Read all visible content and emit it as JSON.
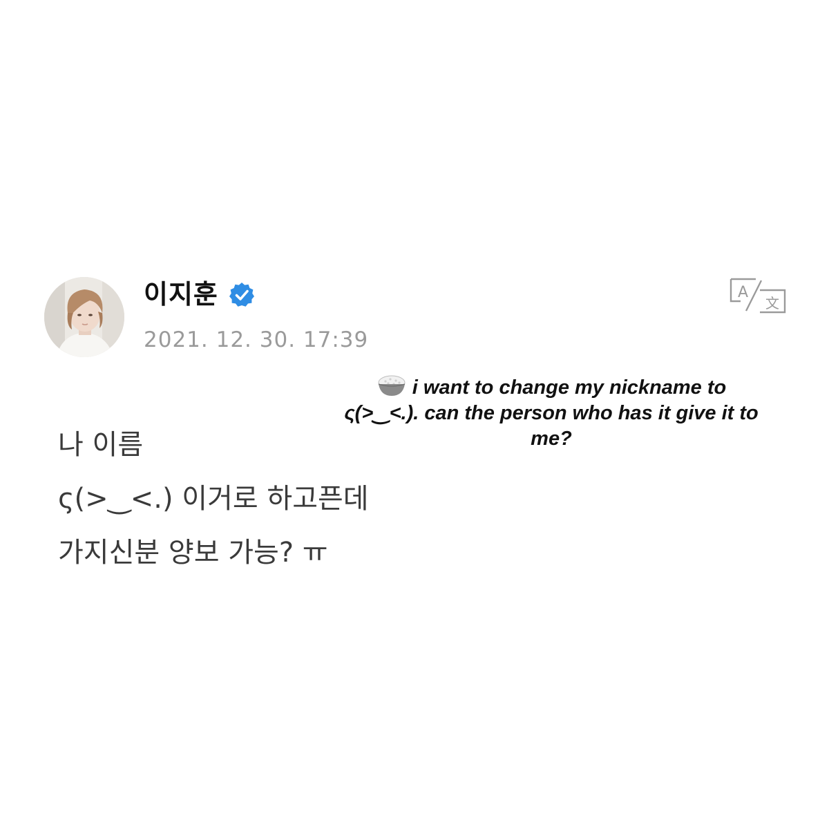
{
  "post": {
    "author": {
      "name": "이지훈",
      "verified": true,
      "avatar_icon": "avatar-photo"
    },
    "timestamp": "2021. 12. 30. 17:39",
    "translate_icon": "translate-icon",
    "body_lines": [
      "나 이름",
      "ς(>‿<.) 이거로 하고픈데",
      "가지신분 양보 가능? ㅠ"
    ]
  },
  "caption": {
    "icon": "rice-bowl-icon",
    "text": "i want to change my nickname to ς(>‿<.). can the person who has it give it to me?"
  },
  "colors": {
    "verified_blue": "#2f8de4",
    "timestamp_gray": "#9a9a9a",
    "body_text": "#3a3a3a",
    "name_text": "#111111"
  }
}
